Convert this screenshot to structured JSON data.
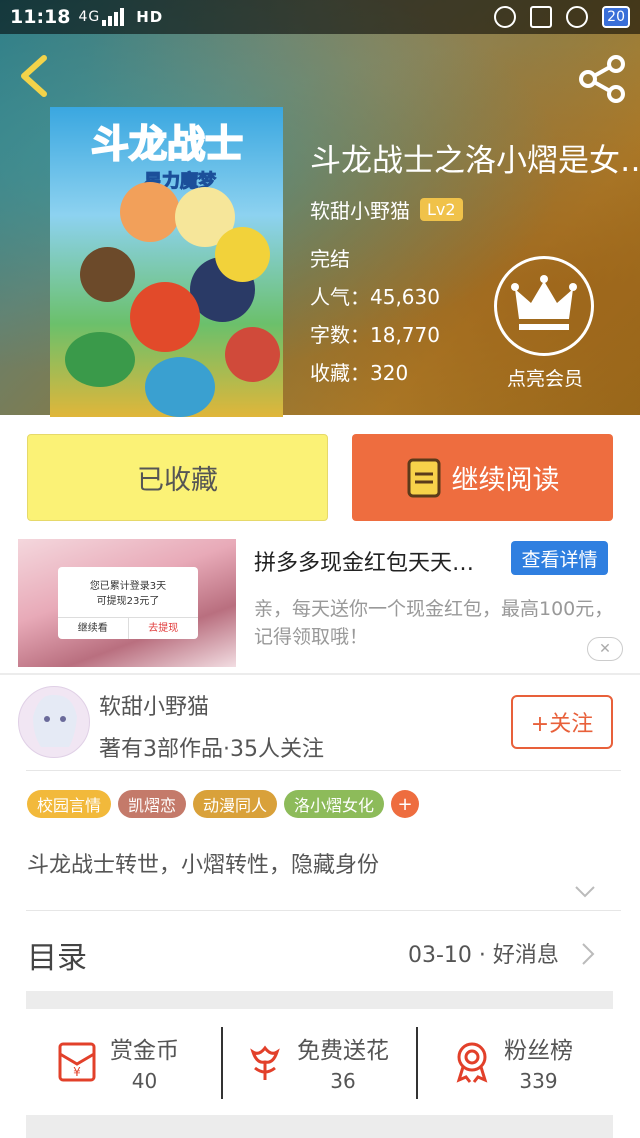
{
  "status_bar": {
    "time": "11:18",
    "signal": "4G",
    "hd": "HD",
    "battery": "20"
  },
  "book": {
    "title": "斗龙战士之洛小熠是女…",
    "author": "软甜小野猫",
    "author_level": "Lv2",
    "status": "完结",
    "popularity_label": "人气：",
    "popularity": "45,630",
    "word_count_label": "字数：",
    "word_count": "18,770",
    "favorites_label": "收藏：",
    "favorites": "320",
    "cover_logo_text": "斗龙战士",
    "cover_sub_text": "星力魔梦"
  },
  "vip": {
    "label": "点亮会员"
  },
  "actions": {
    "favorited_label": "已收藏",
    "continue_label": "继续阅读"
  },
  "ad": {
    "title": "拼多多现金红包天天…",
    "details_label": "查看详情",
    "description": "亲，每天送你一个现金红包，最高100元，记得领取哦！",
    "close_label": "✕",
    "dialog_line1": "您已累计登录3天",
    "dialog_line2": "可提现23元了",
    "dialog_btn1": "继续看",
    "dialog_btn2": "去提现"
  },
  "author_card": {
    "name": "软甜小野猫",
    "meta": "著有3部作品·35人关注",
    "follow_label": "+关注"
  },
  "tags": [
    {
      "label": "校园言情",
      "color": "#f2b93b"
    },
    {
      "label": "凯熠恋",
      "color": "#c47a6a"
    },
    {
      "label": "动漫同人",
      "color": "#d9a13a"
    },
    {
      "label": "洛小熠女化",
      "color": "#8dbb5a"
    }
  ],
  "tag_more": "+",
  "synopsis": "斗龙战士转世，小熠转性，隐藏身份",
  "toc": {
    "label": "目录",
    "update": "03-10 · 好消息"
  },
  "stats": [
    {
      "label": "赏金币",
      "value": "40",
      "icon": "red-envelope-icon"
    },
    {
      "label": "免费送花",
      "value": "36",
      "icon": "flower-icon"
    },
    {
      "label": "粉丝榜",
      "value": "339",
      "icon": "medal-icon"
    }
  ],
  "colors": {
    "accent": "#ee6d3f",
    "favorite_bg": "#fbf276",
    "link_blue": "#2f7fe0",
    "level_badge": "#f0c24a"
  }
}
